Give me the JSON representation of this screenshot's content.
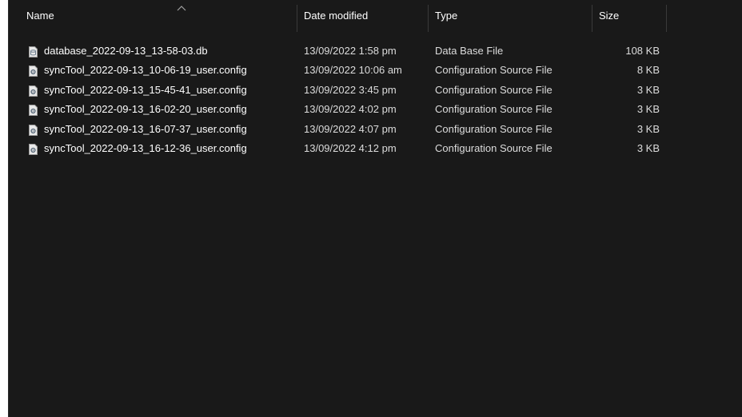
{
  "columns": {
    "name": "Name",
    "date": "Date modified",
    "type": "Type",
    "size": "Size"
  },
  "sort_indicator": "chevron-up-icon",
  "files": [
    {
      "name": "database_2022-09-13_13-58-03.db",
      "date": "13/09/2022 1:58 pm",
      "type": "Data Base File",
      "size": "108 KB",
      "icon": "database-file-icon"
    },
    {
      "name": "syncTool_2022-09-13_10-06-19_user.config",
      "date": "13/09/2022 10:06 am",
      "type": "Configuration Source File",
      "size": "8 KB",
      "icon": "config-file-icon"
    },
    {
      "name": "syncTool_2022-09-13_15-45-41_user.config",
      "date": "13/09/2022 3:45 pm",
      "type": "Configuration Source File",
      "size": "3 KB",
      "icon": "config-file-icon"
    },
    {
      "name": "syncTool_2022-09-13_16-02-20_user.config",
      "date": "13/09/2022 4:02 pm",
      "type": "Configuration Source File",
      "size": "3 KB",
      "icon": "config-file-icon"
    },
    {
      "name": "syncTool_2022-09-13_16-07-37_user.config",
      "date": "13/09/2022 4:07 pm",
      "type": "Configuration Source File",
      "size": "3 KB",
      "icon": "config-file-icon"
    },
    {
      "name": "syncTool_2022-09-13_16-12-36_user.config",
      "date": "13/09/2022 4:12 pm",
      "type": "Configuration Source File",
      "size": "3 KB",
      "icon": "config-file-icon"
    }
  ]
}
